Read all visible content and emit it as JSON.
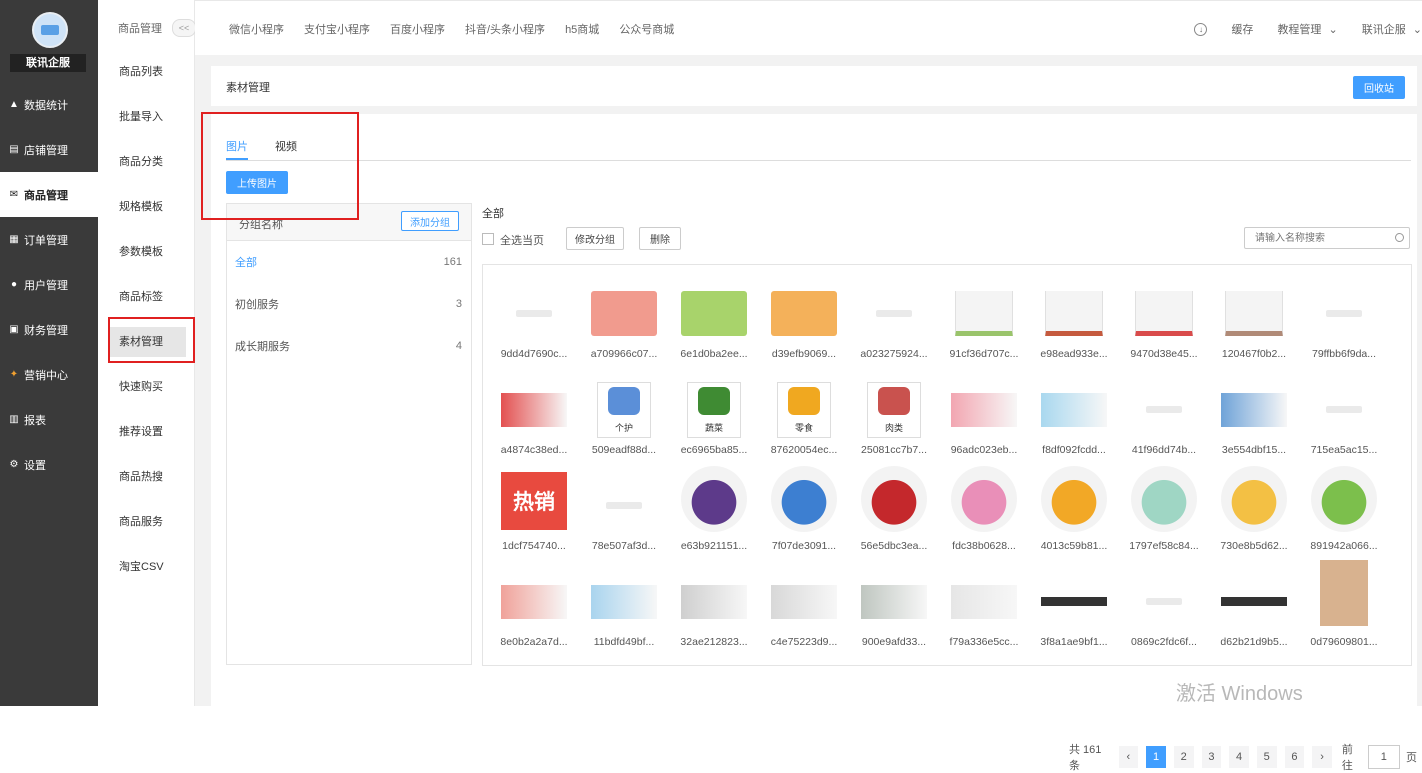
{
  "brand": {
    "name": "联讯企服"
  },
  "sidebar": {
    "items": [
      {
        "label": "数据统计",
        "icon": "chart-icon"
      },
      {
        "label": "店铺管理",
        "icon": "store-icon"
      },
      {
        "label": "商品管理",
        "icon": "goods-icon"
      },
      {
        "label": "订单管理",
        "icon": "order-icon"
      },
      {
        "label": "用户管理",
        "icon": "user-icon"
      },
      {
        "label": "财务管理",
        "icon": "finance-icon"
      },
      {
        "label": "营销中心",
        "icon": "marketing-icon"
      },
      {
        "label": "报表",
        "icon": "report-icon"
      },
      {
        "label": "设置",
        "icon": "settings-icon"
      }
    ],
    "active": 2
  },
  "subnav": {
    "title": "商品管理",
    "collapse": "<<",
    "items": [
      "商品列表",
      "批量导入",
      "商品分类",
      "规格模板",
      "参数模板",
      "商品标签",
      "素材管理",
      "快速购买",
      "推荐设置",
      "商品热搜",
      "商品服务",
      "淘宝CSV"
    ],
    "active": 6
  },
  "topbar": {
    "tabs": [
      "微信小程序",
      "支付宝小程序",
      "百度小程序",
      "抖音/头条小程序",
      "h5商城",
      "公众号商城"
    ],
    "cache": "缓存",
    "tutorial": "教程管理",
    "user": "联讯企服"
  },
  "header": {
    "title": "素材管理",
    "recycle": "回收站"
  },
  "media_tabs": [
    {
      "label": "图片",
      "active": true
    },
    {
      "label": "视频",
      "active": false
    }
  ],
  "upload_label": "上传图片",
  "groups": {
    "title": "分组名称",
    "add_label": "添加分组",
    "items": [
      {
        "name": "全部",
        "count": "161"
      },
      {
        "name": "初创服务",
        "count": "3"
      },
      {
        "name": "成长期服务",
        "count": "4"
      }
    ]
  },
  "toolbar": {
    "current": "全部",
    "select_all": "全选当页",
    "move_group": "修改分组",
    "delete": "删除",
    "search_placeholder": "请输入名称搜索"
  },
  "images": [
    {
      "name": "9dd4d7690c...",
      "kind": "mini"
    },
    {
      "name": "a709966c07...",
      "kind": "card",
      "color": "#f19b8e"
    },
    {
      "name": "6e1d0ba2ee...",
      "kind": "card",
      "color": "#a8d36b"
    },
    {
      "name": "d39efb9069...",
      "kind": "card",
      "color": "#f4b15a"
    },
    {
      "name": "a023275924...",
      "kind": "mini"
    },
    {
      "name": "91cf36d707c...",
      "kind": "prod",
      "color": "#9ac46b"
    },
    {
      "name": "e98ead933e...",
      "kind": "prod",
      "color": "#c55a3e"
    },
    {
      "name": "9470d38e45...",
      "kind": "prod",
      "color": "#d94b4b"
    },
    {
      "name": "120467f0b2...",
      "kind": "prod",
      "color": "#b08a77"
    },
    {
      "name": "79ffbb6f9da...",
      "kind": "mini"
    },
    {
      "name": "a4874c38ed...",
      "kind": "banner",
      "color": "#e35050"
    },
    {
      "name": "509eadf88d...",
      "kind": "box",
      "label": "个护",
      "color": "#5b8fd8"
    },
    {
      "name": "ec6965ba85...",
      "kind": "box",
      "label": "蔬菜",
      "color": "#3f8b33"
    },
    {
      "name": "87620054ec...",
      "kind": "box",
      "label": "零食",
      "color": "#f0a820"
    },
    {
      "name": "25081cc7b7...",
      "kind": "box",
      "label": "肉类",
      "color": "#c9524e"
    },
    {
      "name": "96adc023eb...",
      "kind": "banner",
      "color": "#f2a6b1"
    },
    {
      "name": "f8df092fcdd...",
      "kind": "banner",
      "color": "#a9d8ef"
    },
    {
      "name": "41f96dd74b...",
      "kind": "mini"
    },
    {
      "name": "3e554dbf15...",
      "kind": "banner",
      "color": "#6fa3d8"
    },
    {
      "name": "715ea5ac15...",
      "kind": "mini"
    },
    {
      "name": "1dcf754740...",
      "kind": "hot",
      "label": "热销"
    },
    {
      "name": "78e507af3d...",
      "kind": "mini"
    },
    {
      "name": "e63b921151...",
      "kind": "circle",
      "color": "#5d3a8a"
    },
    {
      "name": "7f07de3091...",
      "kind": "circle",
      "color": "#3d7fd1"
    },
    {
      "name": "56e5dbc3ea...",
      "kind": "circle",
      "color": "#c4282c"
    },
    {
      "name": "fdc38b0628...",
      "kind": "circle",
      "color": "#e98fb8"
    },
    {
      "name": "4013c59b81...",
      "kind": "circle",
      "color": "#f2a826"
    },
    {
      "name": "1797ef58c84...",
      "kind": "circle",
      "color": "#9fd6c4"
    },
    {
      "name": "730e8b5d62...",
      "kind": "circle",
      "color": "#f3c044"
    },
    {
      "name": "891942a066...",
      "kind": "circle",
      "color": "#7cbf4c"
    },
    {
      "name": "8e0b2a2a7d...",
      "kind": "banner",
      "color": "#f0a29a"
    },
    {
      "name": "11bdfd49bf...",
      "kind": "banner",
      "color": "#a9d4ee"
    },
    {
      "name": "32ae212823...",
      "kind": "banner",
      "color": "#cfcfcf"
    },
    {
      "name": "c4e75223d9...",
      "kind": "banner",
      "color": "#d8d8d8"
    },
    {
      "name": "900e9afd33...",
      "kind": "banner",
      "color": "#bfc6c0"
    },
    {
      "name": "f79a336e5cc...",
      "kind": "banner",
      "color": "#e6e6e6"
    },
    {
      "name": "3f8a1ae9bf1...",
      "kind": "dark"
    },
    {
      "name": "0869c2fdc6f...",
      "kind": "mini"
    },
    {
      "name": "d62b21d9b5...",
      "kind": "dark"
    },
    {
      "name": "0d79609801...",
      "kind": "person"
    }
  ],
  "pagination": {
    "total": "共 161 条",
    "pages": [
      "1",
      "2",
      "3",
      "4",
      "5",
      "6"
    ],
    "current": "1",
    "goto_label": "前往",
    "goto_value": "1",
    "page_unit": "页"
  },
  "watermark": "激活 Windows"
}
